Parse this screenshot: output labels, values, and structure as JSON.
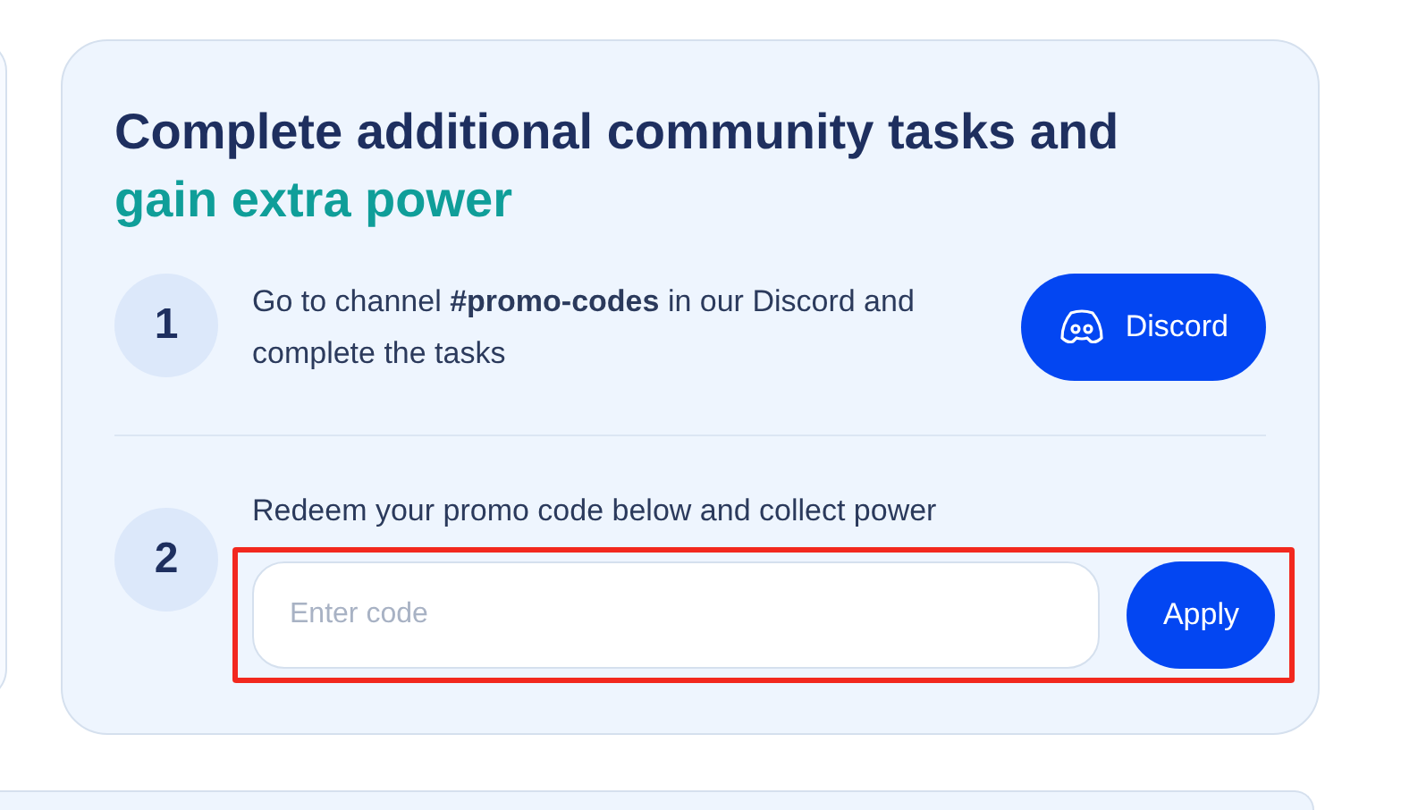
{
  "card": {
    "title": "Complete additional community tasks and",
    "title_accent": "gain extra power"
  },
  "steps": [
    {
      "kind": "link",
      "number": "1",
      "text": "Go to channel **#promo-codes** in our Discord and complete the tasks",
      "button": "Discord"
    },
    {
      "kind": "code",
      "number": "2",
      "text": "Redeem your promo code below and collect power",
      "placeholder": "Enter code",
      "button": "Apply",
      "highlighted": true
    }
  ]
}
